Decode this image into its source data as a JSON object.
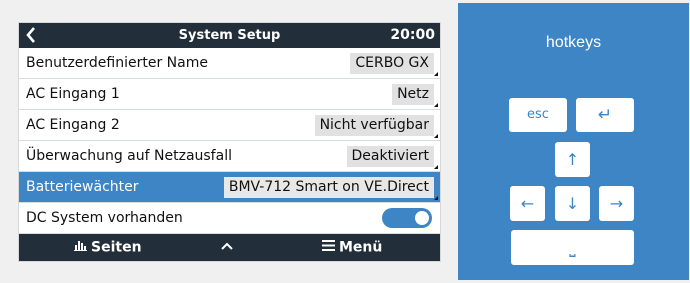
{
  "header": {
    "back_icon": "‹",
    "title": "System Setup",
    "time": "20:00"
  },
  "rows": [
    {
      "label": "Benutzerdefinierter Name",
      "value": "CERBO GX"
    },
    {
      "label": "AC Eingang 1",
      "value": "Netz"
    },
    {
      "label": "AC Eingang 2",
      "value": "Nicht verfügbar"
    },
    {
      "label": "Überwachung auf Netzausfall",
      "value": "Deaktiviert"
    },
    {
      "label": "Batteriewächter",
      "value": "BMV-712 Smart on VE.Direct"
    },
    {
      "label": "DC System vorhanden",
      "toggle_on": true
    }
  ],
  "footer": {
    "pages_label": "Seiten",
    "up_icon": "^",
    "menu_label": "Menü"
  },
  "hotkeys": {
    "title": "hotkeys",
    "esc": "esc",
    "enter": "↵",
    "up": "↑",
    "left": "←",
    "down": "↓",
    "right": "→",
    "space": "⎵"
  },
  "colors": {
    "accent": "#3e85c6",
    "topbar": "#222e3a"
  }
}
